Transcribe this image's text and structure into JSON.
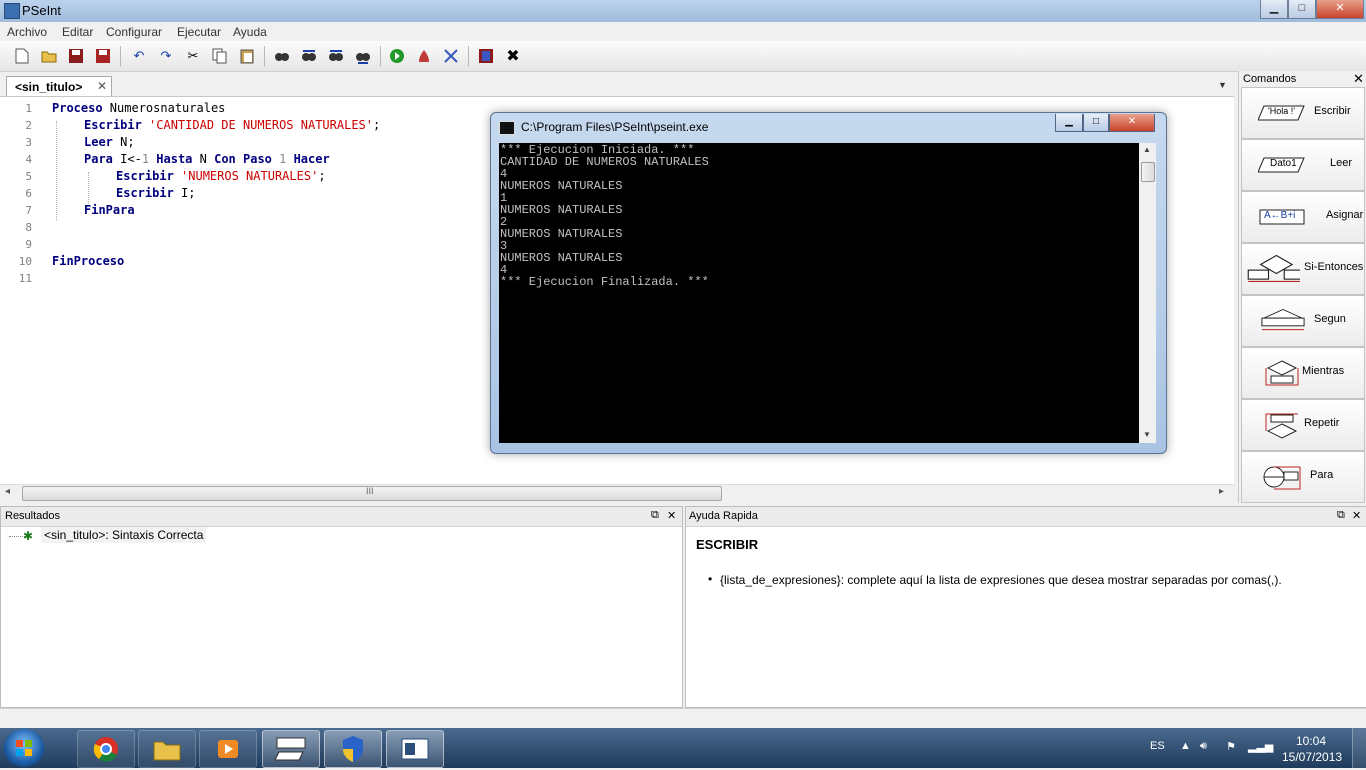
{
  "window": {
    "title": "PSeInt",
    "minimize": "▁",
    "maximize": "□",
    "close": "✕"
  },
  "menu": [
    "Archivo",
    "Editar",
    "Configurar",
    "Ejecutar",
    "Ayuda"
  ],
  "toolbar": {
    "icons": [
      "new-file-icon",
      "open-folder-icon",
      "save-icon",
      "save-as-icon",
      "undo-icon",
      "redo-icon",
      "cut-icon",
      "copy-icon",
      "paste-icon",
      "find-icon",
      "find-prev-icon",
      "find-next-icon",
      "replace-icon",
      "run-icon",
      "step-run-icon",
      "debug-icon",
      "help-icon",
      "close-icon"
    ]
  },
  "editor": {
    "tab_label": "<sin_titulo>",
    "tab_close": "✕",
    "line_numbers": [
      "1",
      "2",
      "3",
      "4",
      "5",
      "6",
      "7",
      "8",
      "9",
      "10",
      "11"
    ],
    "lines": {
      "l1_kw": "Proceso",
      "l1_rest": " Numerosnaturales",
      "l2_kw": "Escribir",
      "l2_str": "'CANTIDAD DE NUMEROS NATURALES'",
      "l2_end": ";",
      "l3_kw": "Leer",
      "l3_rest": " N;",
      "l4_kw1": "Para",
      "l4_a": " I<-",
      "l4_n1": "1",
      "l4_kw2": " Hasta",
      "l4_b": " N ",
      "l4_kw3": "Con Paso",
      "l4_n2": " 1",
      "l4_kw4": " Hacer",
      "l5_kw": "Escribir",
      "l5_str": "'NUMEROS NATURALES'",
      "l5_end": ";",
      "l6_kw": "Escribir",
      "l6_rest": " I;",
      "l7_kw": "FinPara",
      "l10_kw": "FinProceso"
    },
    "hscroll_grip": "III"
  },
  "console": {
    "title": "C:\\Program Files\\PSeInt\\pseint.exe",
    "minimize": "▁",
    "maximize": "□",
    "close": "✕",
    "output": [
      "*** Ejecucion Iniciada. ***",
      "CANTIDAD DE NUMEROS NATURALES",
      "4",
      "NUMEROS NATURALES",
      "1",
      "NUMEROS NATURALES",
      "2",
      "NUMEROS NATURALES",
      "3",
      "NUMEROS NATURALES",
      "4",
      "*** Ejecucion Finalizada. ***"
    ]
  },
  "commands": {
    "title": "Comandos",
    "close": "✕",
    "items": [
      {
        "label": "Escribir",
        "icon_text": "'Hola !'"
      },
      {
        "label": "Leer",
        "icon_text": "Dato1"
      },
      {
        "label": "Asignar",
        "icon_text": "A←B+i"
      },
      {
        "label": "Si-Entonces",
        "icon_text": ""
      },
      {
        "label": "Segun",
        "icon_text": ""
      },
      {
        "label": "Mientras",
        "icon_text": ""
      },
      {
        "label": "Repetir",
        "icon_text": ""
      },
      {
        "label": "Para",
        "icon_text": ""
      }
    ]
  },
  "results": {
    "title": "Resultados",
    "item": "<sin_titulo>: Sintaxis Correcta",
    "btn_restore": "⧉",
    "btn_close": "✕"
  },
  "help": {
    "title": "Ayuda Rapida",
    "heading": "ESCRIBIR",
    "bullet": "{lista_de_expresiones}: complete aquí la lista de expresiones que desea mostrar separadas por comas(,).",
    "btn_restore": "⧉",
    "btn_close": "✕"
  },
  "taskbar": {
    "lang": "ES",
    "time": "10:04",
    "date": "15/07/2013"
  }
}
